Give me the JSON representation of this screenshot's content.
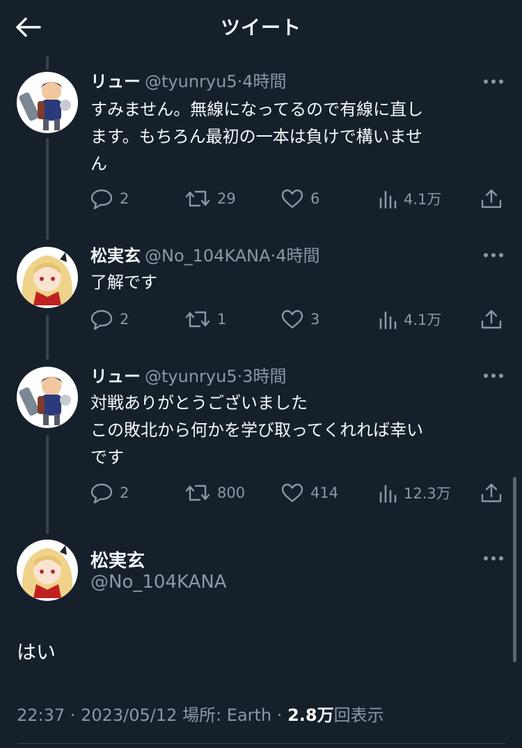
{
  "header": {
    "title": "ツイート"
  },
  "tweets": [
    {
      "name": "リュー",
      "handle": "@tyunryu5",
      "sep": "·",
      "time": "4時間",
      "text": "すみません。無線になってるので有線に直し\nます。もちろん最初の一本は負けで構いませ\nん",
      "replies": "2",
      "retweets": "29",
      "likes": "6",
      "views": "4.1万"
    },
    {
      "name": "松実玄",
      "handle": "@No_104KANA",
      "sep": "·",
      "time": "4時間",
      "text": "了解です",
      "replies": "2",
      "retweets": "1",
      "likes": "3",
      "views": "4.1万"
    },
    {
      "name": "リュー",
      "handle": "@tyunryu5",
      "sep": "·",
      "time": "3時間",
      "text": "対戦ありがとうございました\nこの敗北から何かを学び取ってくれれば幸い\nです",
      "replies": "2",
      "retweets": "800",
      "likes": "414",
      "views": "12.3万"
    }
  ],
  "main_tweet": {
    "name": "松実玄",
    "handle": "@No_104KANA",
    "text": "はい",
    "time": "22:37",
    "date": "2023/05/12",
    "location": "場所: Earth",
    "sep": "·",
    "views_count": "2.8万",
    "views_label": "回表示"
  },
  "icons": {
    "back": "back-arrow-icon",
    "more": "more-dots-icon",
    "reply": "reply-bubble-icon",
    "retweet": "retweet-icon",
    "like": "heart-icon",
    "views": "views-bar-chart-icon",
    "share": "share-upload-icon"
  },
  "colors": {
    "background": "#15202b",
    "text_primary": "#f7f9f9",
    "text_secondary": "#8b98a5",
    "thread_line": "#38444d"
  }
}
